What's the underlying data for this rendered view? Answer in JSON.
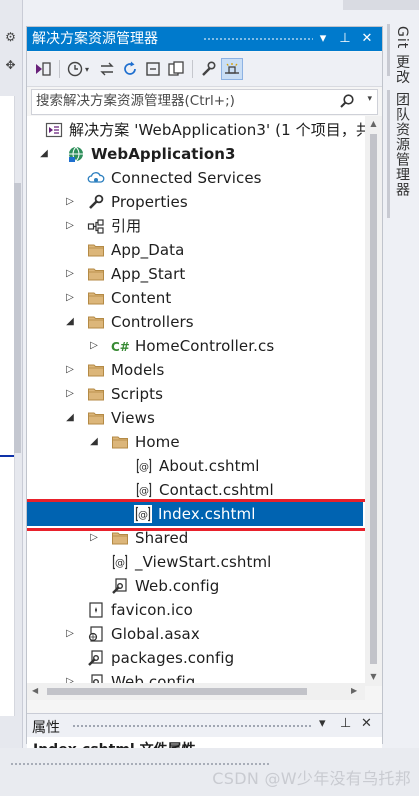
{
  "panel": {
    "title": "解决方案资源管理器",
    "window_controls": {
      "dropdown": "▾",
      "pin": "⊥",
      "close": "✕"
    }
  },
  "search": {
    "placeholder": "搜索解决方案资源管理器(Ctrl+;)"
  },
  "tree": [
    {
      "label": "解决方案 'WebApplication3' (1 个项目，共",
      "icon": "solution-icon",
      "expand": "none",
      "indent": 0
    },
    {
      "label": "WebApplication3",
      "icon": "web-project-icon",
      "expand": "expanded",
      "indent": 0,
      "bold": true
    },
    {
      "label": "Connected Services",
      "icon": "cloud-icon",
      "expand": "none",
      "indent": 1
    },
    {
      "label": "Properties",
      "icon": "wrench-icon",
      "expand": "collapsed",
      "indent": 1
    },
    {
      "label": "引用",
      "icon": "references-icon",
      "expand": "collapsed",
      "indent": 1
    },
    {
      "label": "App_Data",
      "icon": "folder-icon",
      "expand": "none",
      "indent": 1
    },
    {
      "label": "App_Start",
      "icon": "folder-icon",
      "expand": "collapsed",
      "indent": 1
    },
    {
      "label": "Content",
      "icon": "folder-icon",
      "expand": "collapsed",
      "indent": 1
    },
    {
      "label": "Controllers",
      "icon": "folder-icon",
      "expand": "expanded",
      "indent": 1
    },
    {
      "label": "HomeController.cs",
      "icon": "csharp-file-icon",
      "expand": "collapsed",
      "indent": 2
    },
    {
      "label": "Models",
      "icon": "folder-icon",
      "expand": "collapsed",
      "indent": 1
    },
    {
      "label": "Scripts",
      "icon": "folder-icon",
      "expand": "collapsed",
      "indent": 1
    },
    {
      "label": "Views",
      "icon": "folder-icon",
      "expand": "expanded",
      "indent": 1
    },
    {
      "label": "Home",
      "icon": "folder-icon",
      "expand": "expanded",
      "indent": 2
    },
    {
      "label": "About.cshtml",
      "icon": "razor-file-icon",
      "expand": "none",
      "indent": 3
    },
    {
      "label": "Contact.cshtml",
      "icon": "razor-file-icon",
      "expand": "none",
      "indent": 3
    },
    {
      "label": "Index.cshtml",
      "icon": "razor-file-icon",
      "expand": "none",
      "indent": 3,
      "selected": true
    },
    {
      "label": "Shared",
      "icon": "folder-icon",
      "expand": "collapsed",
      "indent": 2
    },
    {
      "label": "_ViewStart.cshtml",
      "icon": "razor-file-icon",
      "expand": "none",
      "indent": 2
    },
    {
      "label": "Web.config",
      "icon": "config-file-icon",
      "expand": "none",
      "indent": 2
    },
    {
      "label": "favicon.ico",
      "icon": "ico-file-icon",
      "expand": "none",
      "indent": 1
    },
    {
      "label": "Global.asax",
      "icon": "asax-file-icon",
      "expand": "collapsed",
      "indent": 1
    },
    {
      "label": "packages.config",
      "icon": "config-file-icon",
      "expand": "none",
      "indent": 1
    },
    {
      "label": "Web.config",
      "icon": "config-file-icon",
      "expand": "collapsed",
      "indent": 1
    }
  ],
  "properties": {
    "title": "属性",
    "subtitle": "Index.cshtml 文件属性"
  },
  "right_tabs": [
    {
      "label": "Git 更改"
    },
    {
      "label": "团队资源管理器"
    }
  ],
  "watermark": "CSDN @W少年没有乌托邦",
  "colors": {
    "accent": "#007acc",
    "selection": "#0063b1",
    "highlight_box": "#e8212b",
    "folder": "#dcb67a"
  }
}
